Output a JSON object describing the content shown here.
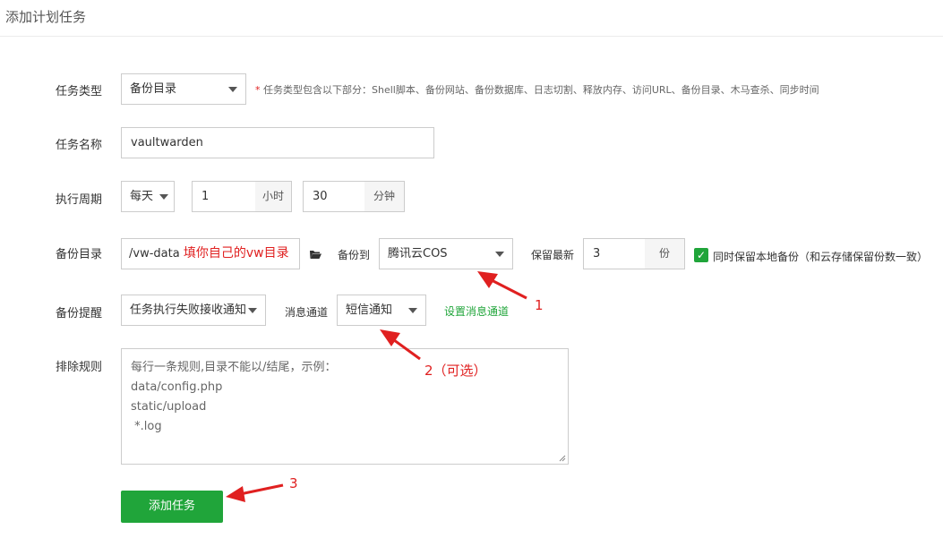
{
  "header": {
    "title": "添加计划任务"
  },
  "task_type": {
    "label": "任务类型",
    "value": "备份目录",
    "hint_star": "*",
    "hint": "任务类型包含以下部分：Shell脚本、备份网站、备份数据库、日志切割、释放内存、访问URL、备份目录、木马查杀、同步时间"
  },
  "task_name": {
    "label": "任务名称",
    "value": "vaultwarden"
  },
  "period": {
    "label": "执行周期",
    "freq": "每天",
    "hour_value": "1",
    "hour_unit": "小时",
    "minute_value": "30",
    "minute_unit": "分钟"
  },
  "backup_dir": {
    "label": "备份目录",
    "path": "/vw-data",
    "path_note": "填你自己的vw目录",
    "backup_to_label": "备份到",
    "backup_to_value": "腾讯云COS",
    "keep_label": "保留最新",
    "keep_value": "3",
    "keep_unit": "份",
    "keep_local_checked": true,
    "keep_local_label": "同时保留本地备份（和云存储保留份数一致）"
  },
  "reminder": {
    "label": "备份提醒",
    "value": "任务执行失败接收通知",
    "channel_label": "消息通道",
    "channel_value": "短信通知",
    "setup_link": "设置消息通道"
  },
  "exclude": {
    "label": "排除规则",
    "lines": [
      "每行一条规则,目录不能以/结尾，示例：",
      "data/config.php",
      "static/upload",
      " *.log"
    ]
  },
  "submit": {
    "label": "添加任务"
  },
  "annotations": {
    "a1": "1",
    "a2": "2（可选）",
    "a3": "3"
  },
  "colors": {
    "accent": "#20a53a",
    "annotation": "#e02020"
  },
  "icons": {
    "caret": "chevron-down-icon",
    "folder": "folder-open-icon",
    "check": "checkbox-check-icon"
  }
}
